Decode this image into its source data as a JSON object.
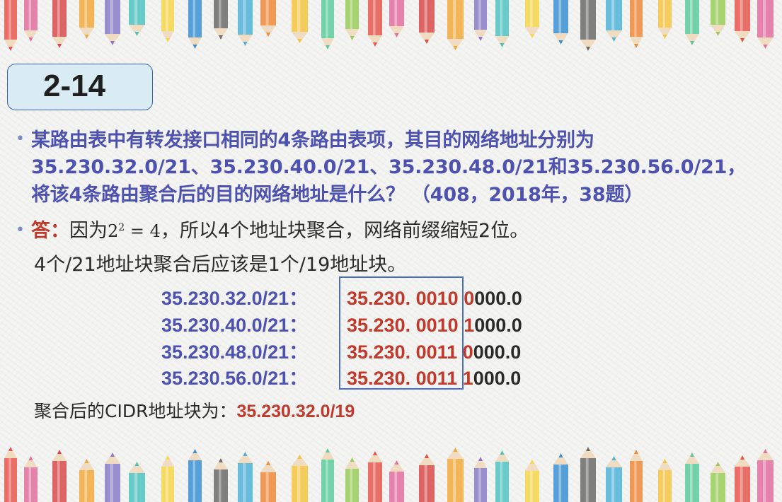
{
  "slide_id": "2-14",
  "question": {
    "line1": "某路由表中有转发接口相同的4条路由表项，其目的网络地址分别为",
    "line2": "35.230.32.0/21、35.230.40.0/21、35.230.48.0/21和35.230.56.0/21，",
    "line3": "将该4条路由聚合后的目的网络地址是什么？ （408，2018年，38题）"
  },
  "answer": {
    "label": "答：",
    "text_before": "因为",
    "math": "2² = 4",
    "text_after": "，所以4个地址块聚合，网络前缀缩短2位。",
    "line2": "4个/21地址块聚合后应该是1个/19地址块。"
  },
  "addresses": [
    {
      "cidr": "35.230.32.0/21：",
      "prefix": "35.230. 001",
      "bit": "0",
      "pad": " ",
      "bit2": "0",
      "rest": "000.0"
    },
    {
      "cidr": "35.230.40.0/21：",
      "prefix": "35.230. 001",
      "bit": "0",
      "pad": " ",
      "bit2": "1",
      "rest": "000.0"
    },
    {
      "cidr": "35.230.48.0/21：",
      "prefix": "35.230. 001",
      "bit": "1",
      "pad": " ",
      "bit2": "0",
      "rest": "000.0"
    },
    {
      "cidr": "35.230.56.0/21：",
      "prefix": "35.230. 001",
      "bit": "1",
      "pad": " ",
      "bit2": "1",
      "rest": "000.0"
    }
  ],
  "result": {
    "label": "聚合后的CIDR地址块为：",
    "value": "35.230.32.0/19"
  },
  "colors": {
    "question": "#4d52b0",
    "answer_label": "#c0392b",
    "title_box": "#d9ecf4",
    "box_border": "#4a6fc0"
  }
}
